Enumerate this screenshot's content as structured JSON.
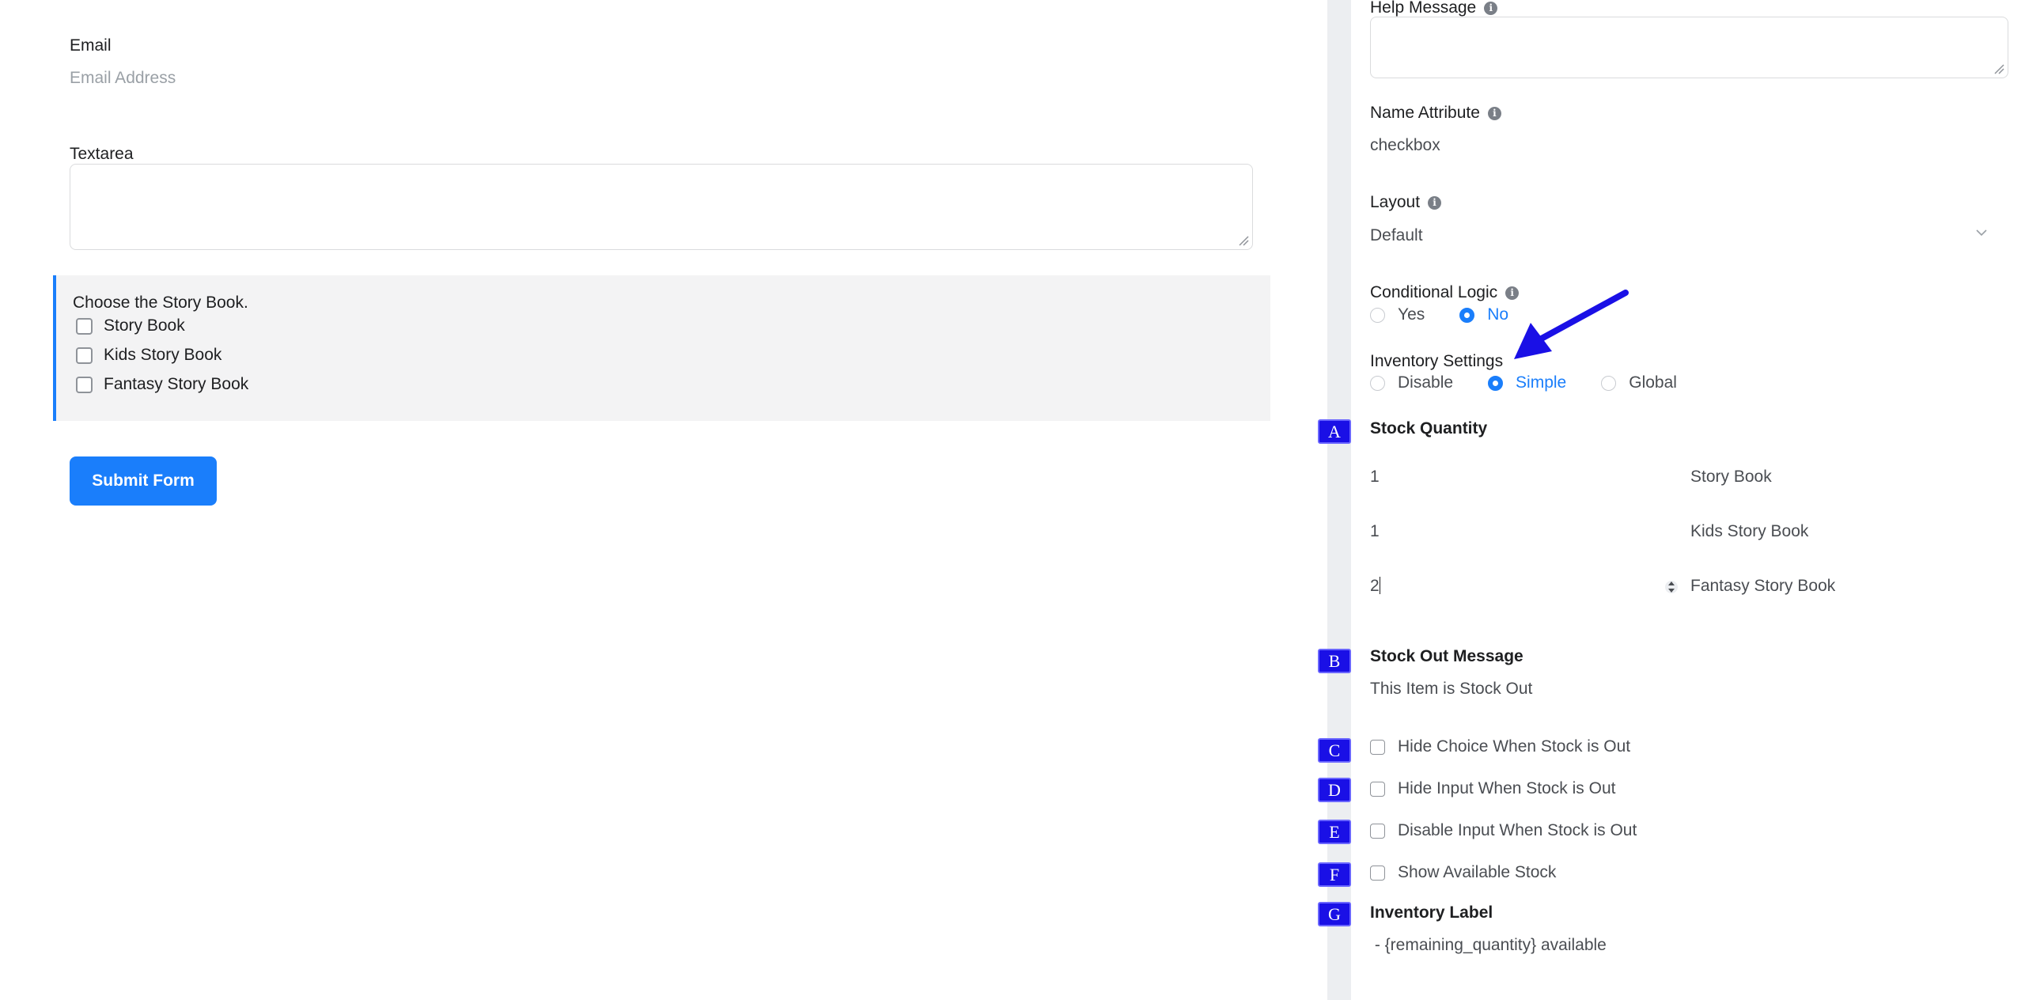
{
  "preview": {
    "email": {
      "label": "Email",
      "placeholder": "Email Address"
    },
    "textarea": {
      "label": "Textarea"
    },
    "checkbox_group": {
      "label": "Choose the Story Book.",
      "options": [
        "Story Book",
        "Kids Story Book",
        "Fantasy Story Book"
      ]
    },
    "submit_label": "Submit Form"
  },
  "settings": {
    "help_message": {
      "label": "Help Message",
      "info_icon": "i"
    },
    "name_attribute": {
      "label": "Name Attribute",
      "value": "checkbox"
    },
    "layout": {
      "label": "Layout",
      "value": "Default"
    },
    "conditional_logic": {
      "label": "Conditional Logic",
      "options": [
        "Yes",
        "No"
      ],
      "selected": "No"
    },
    "inventory_settings": {
      "label": "Inventory Settings",
      "options": [
        "Disable",
        "Simple",
        "Global"
      ],
      "selected": "Simple"
    },
    "stock_quantity": {
      "label": "Stock Quantity",
      "rows": [
        {
          "qty": "1",
          "name": "Story Book"
        },
        {
          "qty": "1",
          "name": "Kids Story Book"
        },
        {
          "qty": "2",
          "name": "Fantasy Story Book"
        }
      ]
    },
    "stock_out_message": {
      "label": "Stock Out Message",
      "value": "This Item is Stock Out"
    },
    "checkboxes": [
      "Hide Choice When Stock is Out",
      "Hide Input When Stock is Out",
      "Disable Input When Stock is Out",
      "Show Available Stock"
    ],
    "inventory_label": {
      "label": "Inventory Label",
      "value": " - {remaining_quantity} available"
    }
  },
  "annotations": {
    "tags": [
      "A",
      "B",
      "C",
      "D",
      "E",
      "F",
      "G"
    ],
    "arrow_color": "#1a10e6"
  },
  "colors": {
    "accent": "#1a7efb",
    "annotation": "#1a10e6",
    "group_bg": "#f3f3f4"
  }
}
